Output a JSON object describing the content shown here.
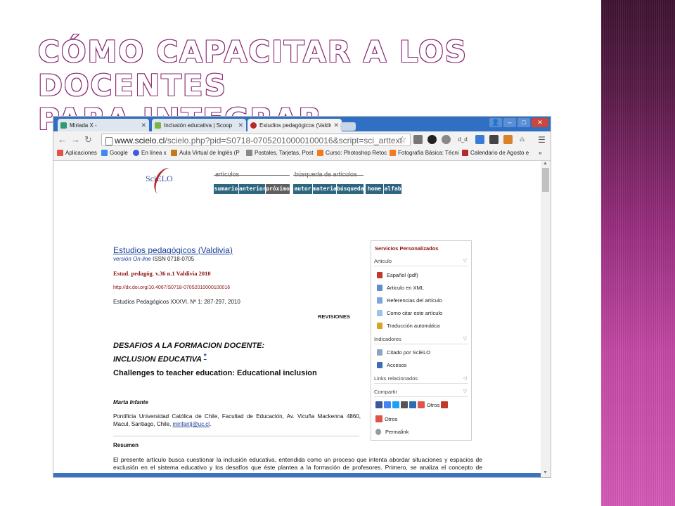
{
  "slide": {
    "title_line1": "CÓMO CAPACITAR A LOS DOCENTES",
    "title_line2": "PARA INTEGRAR"
  },
  "browser": {
    "tabs": [
      {
        "label": "Miriada X -"
      },
      {
        "label": "Inclusión educativa | Scoop"
      },
      {
        "label": "Estudios pedagógicos (Valdiv"
      }
    ],
    "address": "www.scielo.cl/scielo.php?pid=S0718-07052010000100016&script=sci_arttext",
    "address_host": "www.scielo.cl",
    "address_rest": "/scielo.php?pid=S0718-07052010000100016&script=sci_arttext",
    "extension_label": "d_d",
    "bookmarks": [
      "Aplicaciones",
      "Google",
      "En línea x",
      "Aula Virtual de Inglés (P",
      "Postales, Tarjetas, Post",
      "Curso: Photoshop Retoc",
      "Fotografía Básica: Técni",
      "Calendario de Agosto e"
    ],
    "bookmarks_more": "»"
  },
  "scielo": {
    "logo": "SciELO",
    "group_articulos": "artículos",
    "group_busqueda": "búsqueda de artículos",
    "nav_buttons": [
      "sumario",
      "anterior",
      "próximo",
      "autor",
      "materia",
      "búsqueda",
      "home",
      "alfab"
    ]
  },
  "article": {
    "journal": "Estudios pedagógicos (Valdivia)",
    "online_prefix": "versión On-line",
    "issn": "ISSN 0718-0705",
    "citation": "Estud. pedagóg. v.36 n.1 Valdivia  2010",
    "doi": "http://dx.doi.org/10.4067/S0718-07052010000100016",
    "volume": "Estudios Pedagógicos XXXVI, Nº 1: 287-297, 2010",
    "section": "REVISIONES",
    "title_line1": "DESAFIOS A LA FORMACION DOCENTE:",
    "title_line2": "INCLUSION EDUCATIVA",
    "title_footnote": "*",
    "subtitle": "Challenges to teacher education: Educational inclusion",
    "author": "Marta Infante",
    "affiliation": "Pontificia Universidad Católica de Chile, Facultad de Educación, Av. Vicuña Mackenna 4860, Macul, Santiago, Chile,",
    "email": "minfantj@uc.cl",
    "resumen_heading": "Resumen",
    "resumen_text": "El presente artículo busca cuestionar la inclusión educativa, entendida como un proceso que intenta abordar situaciones y espacios de exclusión en el sistema educativo y los desafíos que éste plantea a la formación de profesores. Primero, se analiza el concepto de inclusión desde una perspectiva"
  },
  "panel": {
    "heading": "Servicios Personalizados",
    "sec_articulo": "Articulo",
    "articulo_items": [
      "Español (pdf)",
      "Articulo en XML",
      "Referencias del artículo",
      "Como citar este artículo",
      "Traducción automática"
    ],
    "sec_indicadores": "Indicadores",
    "indicadores_items": [
      "Citado por SciELO",
      "Accesos"
    ],
    "sec_links": "Links relacionados",
    "sec_compartir": "Compartir",
    "otros1": "Otros",
    "otros2": "Otros",
    "permalink": "Permalink"
  },
  "colors": {
    "title_outline": "#8a2a74",
    "stripe": "#9a2e80",
    "scielo_nav": "#2d6680",
    "panel_heading": "#8a1212",
    "link": "#1a3f9a"
  }
}
